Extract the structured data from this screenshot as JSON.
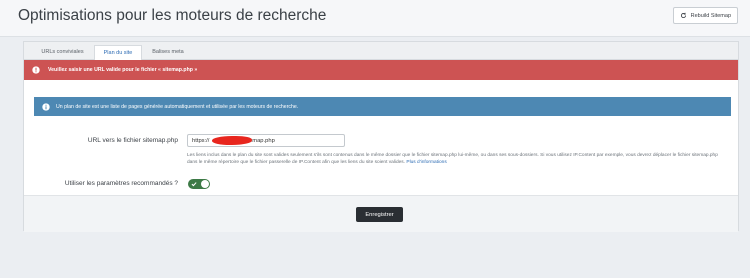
{
  "header": {
    "title": "Optimisations pour les moteurs de recherche",
    "rebuild_label": "Rebuild Sitemap"
  },
  "tabs": [
    {
      "label": "URLs conviviales",
      "active": false
    },
    {
      "label": "Plan du site",
      "active": true
    },
    {
      "label": "Balises meta",
      "active": false
    }
  ],
  "alerts": {
    "error": "Veuillez saisir une URL valide pour le fichier « sitemap.php »",
    "info": "Un plan de site est une liste de pages générée automatiquement et utilisée par les moteurs de recherche."
  },
  "form": {
    "url_label": "URL vers le fichier sitemap.php",
    "url_value": "https://                    /sitemap.php",
    "help_text": "Les liens inclus dans le plan du site sont valides seulement s'ils sont contenus dans le même dossier que le fichier sitemap.php lui-même, ou dans ses sous-dossiers. Si vous utilisez IP.Content par exemple, vous devrez déplacer le fichier sitemap.php dans le même répertoire que le fichier passerelle de IP.Content afin que les liens du site soient valides.",
    "help_link": "Plus d'informations",
    "recommended_label": "Utiliser les paramètres recommandés ?",
    "recommended_on": true
  },
  "footer": {
    "save_label": "Enregistrer"
  },
  "colors": {
    "error_bg": "#cd5353",
    "info_bg": "#4d88b3",
    "toggle_on": "#3d7a46",
    "active_tab_text": "#2d6cb4"
  }
}
